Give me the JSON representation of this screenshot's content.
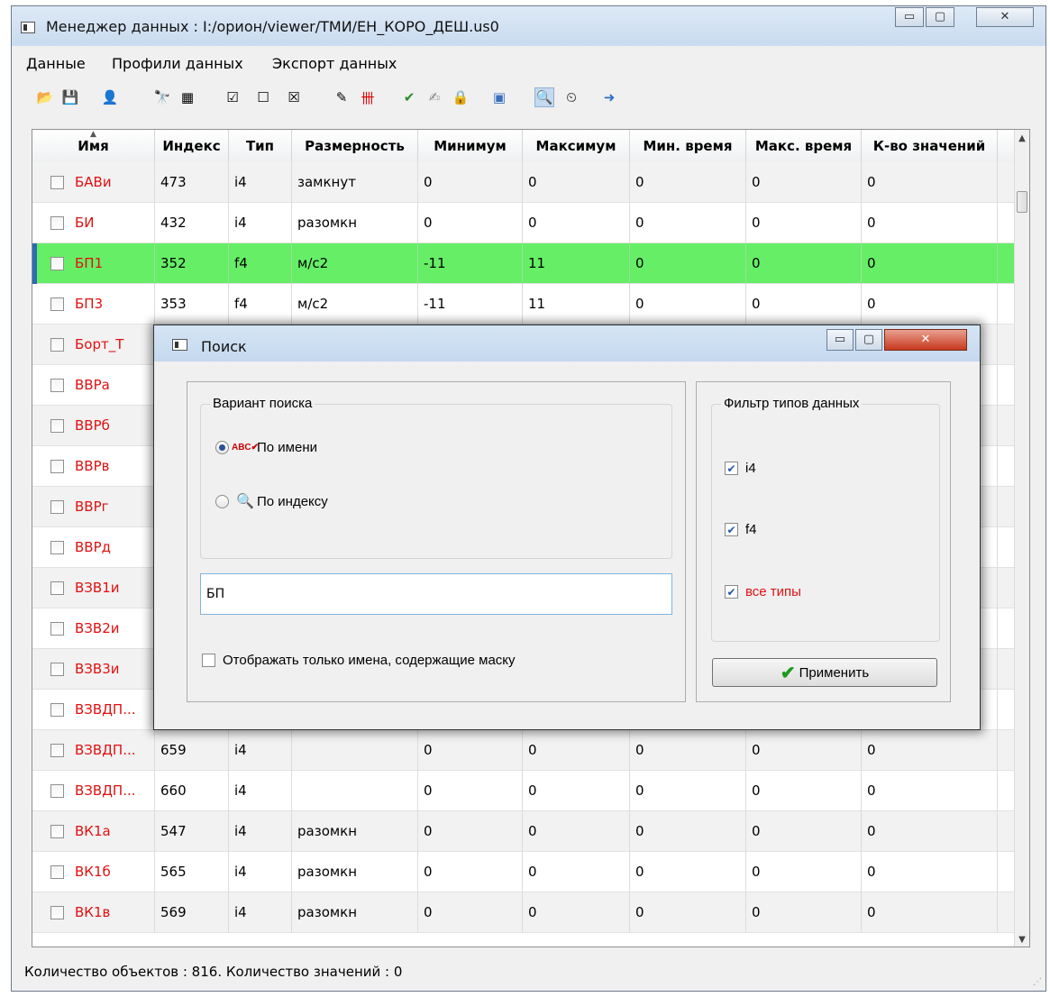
{
  "window": {
    "title": "Менеджер данных : I:/орион/viewer/ТМИ/ЕН_КОРО_ДЕШ.us0",
    "minimize": "▭",
    "maximize": "▢",
    "close": "✕"
  },
  "menu": [
    "Данные",
    "Профили данных",
    "Экспорт данных"
  ],
  "toolbar_icons": [
    "open-icon",
    "save-icon",
    "profile-icon",
    "binoculars-icon",
    "select-area-icon",
    "check-all-icon",
    "uncheck-all-icon",
    "clear-checks-icon",
    "edit-icon",
    "chart-icon",
    "approve-icon",
    "edit-doc-icon",
    "lock-icon",
    "window-icon",
    "search-icon",
    "clock-search-icon",
    "exit-icon"
  ],
  "table": {
    "columns": [
      "Имя",
      "Индекс",
      "Тип",
      "Размерность",
      "Минимум",
      "Максимум",
      "Мин. время",
      "Макс. время",
      "К-во значений"
    ],
    "rows": [
      {
        "name": "БАВи",
        "cells": [
          "473",
          "i4",
          "замкнут",
          "0",
          "0",
          "0",
          "0",
          "0"
        ]
      },
      {
        "name": "БИ",
        "cells": [
          "432",
          "i4",
          "разомкн",
          "0",
          "0",
          "0",
          "0",
          "0"
        ]
      },
      {
        "name": "БП1",
        "cells": [
          "352",
          "f4",
          "м/с2",
          "-11",
          "11",
          "0",
          "0",
          "0"
        ],
        "selected": true
      },
      {
        "name": "БП3",
        "cells": [
          "353",
          "f4",
          "м/с2",
          "-11",
          "11",
          "0",
          "0",
          "0"
        ]
      },
      {
        "name": "Борт_Т",
        "cells": [
          "",
          "",
          "",
          "",
          "",
          "",
          "",
          ""
        ]
      },
      {
        "name": "ВВРа",
        "cells": [
          "",
          "",
          "",
          "",
          "",
          "",
          "",
          ""
        ]
      },
      {
        "name": "ВВРб",
        "cells": [
          "",
          "",
          "",
          "",
          "",
          "",
          "",
          ""
        ]
      },
      {
        "name": "ВВРв",
        "cells": [
          "",
          "",
          "",
          "",
          "",
          "",
          "",
          ""
        ]
      },
      {
        "name": "ВВРг",
        "cells": [
          "",
          "",
          "",
          "",
          "",
          "",
          "",
          ""
        ]
      },
      {
        "name": "ВВРд",
        "cells": [
          "",
          "",
          "",
          "",
          "",
          "",
          "",
          ""
        ]
      },
      {
        "name": "ВЗВ1и",
        "cells": [
          "",
          "",
          "",
          "",
          "",
          "",
          "",
          ""
        ]
      },
      {
        "name": "ВЗВ2и",
        "cells": [
          "",
          "",
          "",
          "",
          "",
          "",
          "",
          ""
        ]
      },
      {
        "name": "ВЗВ3и",
        "cells": [
          "",
          "",
          "",
          "",
          "",
          "",
          "",
          ""
        ]
      },
      {
        "name": "ВЗВДП...",
        "cells": [
          "",
          "",
          "",
          "",
          "",
          "",
          "",
          ""
        ]
      },
      {
        "name": "ВЗВДП...",
        "cells": [
          "659",
          "i4",
          "",
          "0",
          "0",
          "0",
          "0",
          "0"
        ]
      },
      {
        "name": "ВЗВДП...",
        "cells": [
          "660",
          "i4",
          "",
          "0",
          "0",
          "0",
          "0",
          "0"
        ]
      },
      {
        "name": "ВК1а",
        "cells": [
          "547",
          "i4",
          "разомкн",
          "0",
          "0",
          "0",
          "0",
          "0"
        ]
      },
      {
        "name": "ВК1б",
        "cells": [
          "565",
          "i4",
          "разомкн",
          "0",
          "0",
          "0",
          "0",
          "0"
        ]
      },
      {
        "name": "ВК1в",
        "cells": [
          "569",
          "i4",
          "разомкн",
          "0",
          "0",
          "0",
          "0",
          "0"
        ]
      }
    ]
  },
  "status": "Количество объектов : 816.  Количество значений : 0",
  "dialog": {
    "title": "Поиск",
    "search_variant": {
      "label": "Вариант поиска",
      "by_name": "По имени",
      "by_index": "По индексу",
      "by_name_icon": "ABC✔",
      "selected": "by_name"
    },
    "search_value": "БП",
    "mask_only_label": "Отображать только имена,  содержащие маску",
    "type_filter": {
      "label": "Фильтр типов данных",
      "options": [
        {
          "label": "i4",
          "checked": true,
          "color": "#000000"
        },
        {
          "label": "f4",
          "checked": true,
          "color": "#000000"
        },
        {
          "label": "все типы",
          "checked": true,
          "color": "#e01010"
        }
      ]
    },
    "apply_label": "Применить"
  },
  "colors": {
    "selected_row": "#66ee66",
    "name_text": "#e01010",
    "check_mark": "#1a9a1a"
  }
}
